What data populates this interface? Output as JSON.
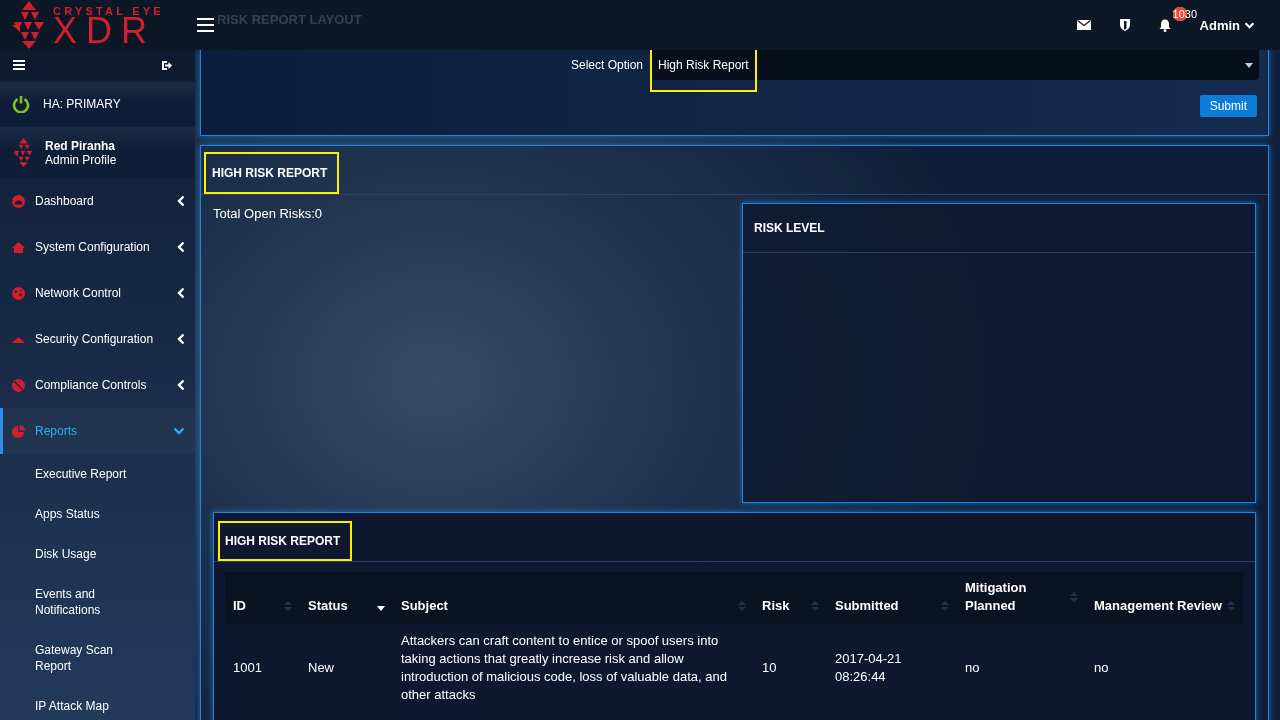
{
  "header": {
    "logo": {
      "tagline": "CRYSTAL EYE",
      "wordmark": "XDR"
    },
    "page_title": "RISK REPORT LAYOUT",
    "notifications": "1030",
    "user": "Admin"
  },
  "sidebar": {
    "ha_status": "HA: PRIMARY",
    "profile": {
      "name": "Red Piranha",
      "role": "Admin Profile"
    },
    "items": [
      {
        "label": "Dashboard",
        "selected": false,
        "expanded": false
      },
      {
        "label": "System Configuration",
        "selected": false,
        "expanded": false
      },
      {
        "label": "Network Control",
        "selected": false,
        "expanded": false
      },
      {
        "label": "Security Configuration",
        "selected": false,
        "expanded": false
      },
      {
        "label": "Compliance Controls",
        "selected": false,
        "expanded": false
      },
      {
        "label": "Reports",
        "selected": true,
        "expanded": true,
        "children": [
          {
            "label": "Executive Report",
            "selected": false
          },
          {
            "label": "Apps Status",
            "selected": false
          },
          {
            "label": "Disk Usage",
            "selected": false
          },
          {
            "label": "Events and Notifications",
            "selected": false
          },
          {
            "label": "Gateway Scan Report",
            "selected": false
          },
          {
            "label": "IP Attack Map",
            "selected": false
          }
        ]
      }
    ]
  },
  "select_panel": {
    "label": "Select Option",
    "value": "High Risk Report",
    "highlighted": true,
    "button": "Submit"
  },
  "report_panel": {
    "title": "HIGH RISK REPORT",
    "highlighted": true,
    "summary": "Total Open Risks:0",
    "risk_level": {
      "title": "RISK LEVEL"
    },
    "table_panel": {
      "title": "HIGH RISK REPORT",
      "highlighted": true,
      "columns": [
        {
          "label": "ID",
          "sorted": false
        },
        {
          "label": "Status",
          "sorted": true
        },
        {
          "label": "Subject",
          "sorted": false
        },
        {
          "label": "Risk",
          "sorted": false
        },
        {
          "label": "Submitted",
          "sorted": false
        },
        {
          "label": "Mitigation Planned",
          "sorted": false
        },
        {
          "label": "Management Review",
          "sorted": false
        }
      ],
      "rows": [
        [
          "1001",
          "New",
          "Attackers can craft content to entice or spoof users into taking actions that greatly increase risk and allow introduction of malicious code, loss of valuable data, and other attacks",
          "10",
          "2017-04-21 08:26:44",
          "no",
          "no"
        ]
      ]
    }
  }
}
